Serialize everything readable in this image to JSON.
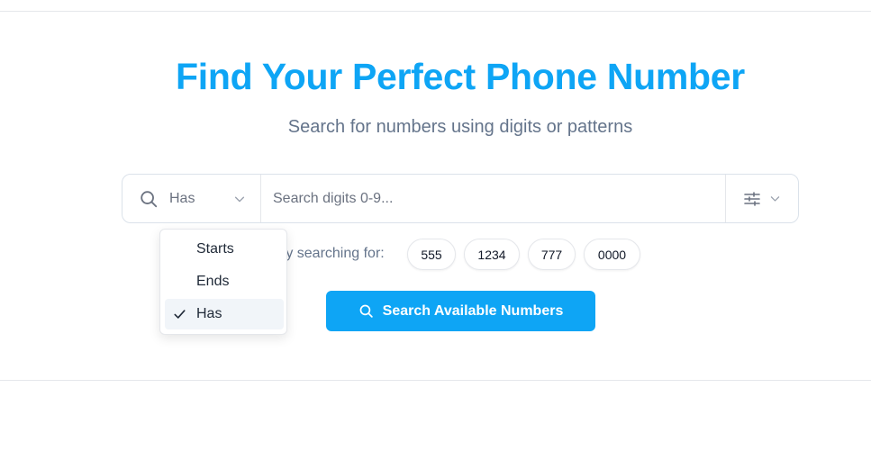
{
  "header": {
    "title": "Find Your Perfect Phone Number",
    "subtitle": "Search for numbers using digits or patterns"
  },
  "search": {
    "mode_label": "Has",
    "placeholder": "Search digits 0-9...",
    "value": ""
  },
  "suggestions": {
    "label": "ry searching for:",
    "chips": [
      "555",
      "1234",
      "777",
      "0000"
    ]
  },
  "search_button": {
    "label": "Search Available Numbers"
  },
  "mode_dropdown": {
    "options": [
      "Starts",
      "Ends",
      "Has"
    ],
    "selected": "Has"
  },
  "colors": {
    "accent": "#0ea5f5",
    "muted_text": "#64748b",
    "border": "#e5e7eb"
  },
  "icons": [
    "search-icon",
    "chevron-down-icon",
    "sliders-icon",
    "check-icon"
  ]
}
